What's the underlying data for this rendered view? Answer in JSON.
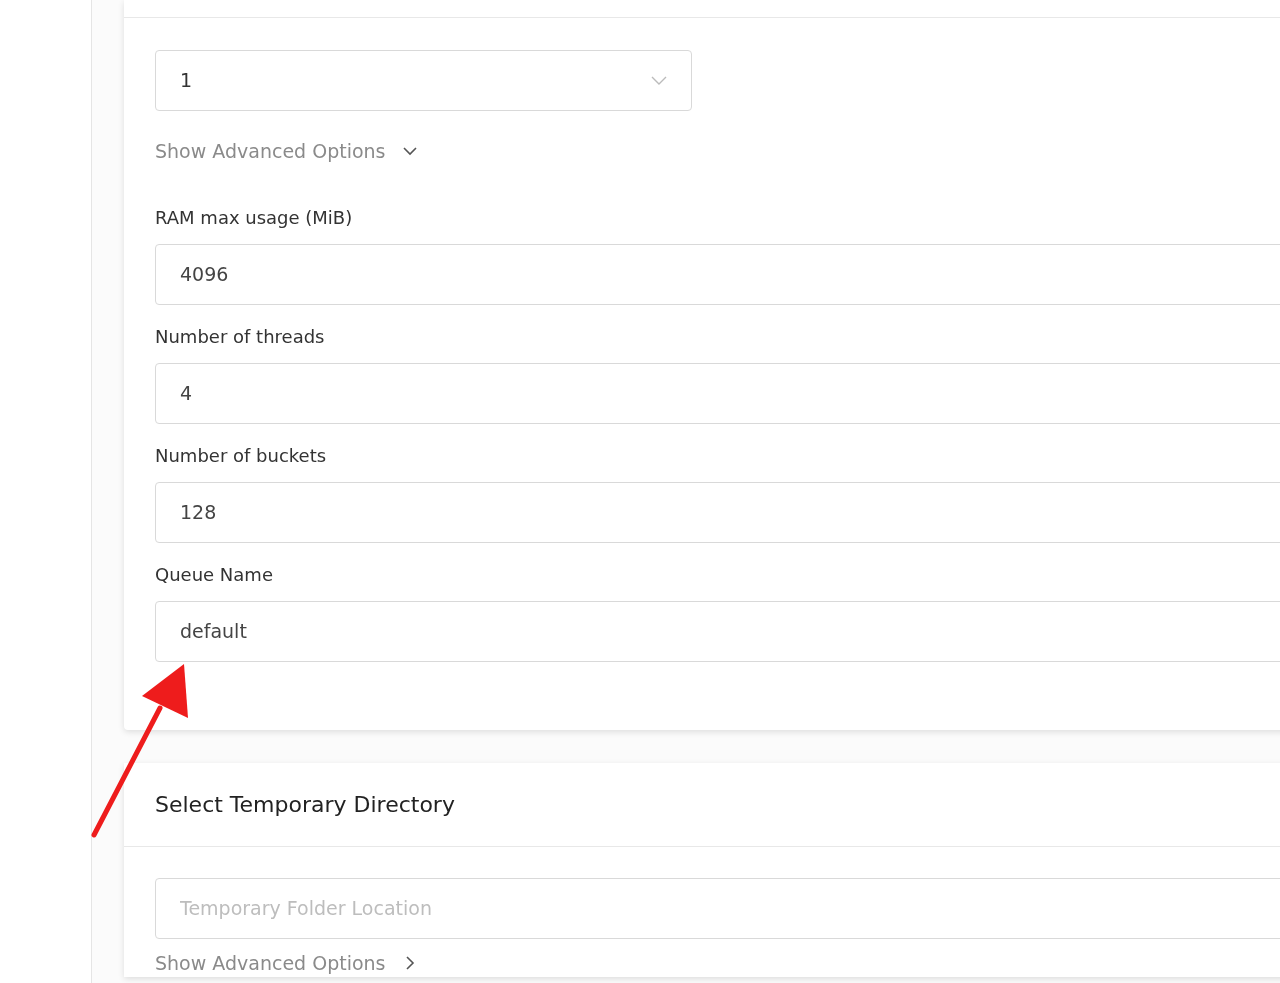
{
  "plot_card": {
    "select": {
      "value": "1"
    },
    "advanced": {
      "label": "Show Advanced Options",
      "expanded": true
    },
    "fields": [
      {
        "label": "RAM max usage (MiB)",
        "value": "4096"
      },
      {
        "label": "Number of threads",
        "value": "4"
      },
      {
        "label": "Number of buckets",
        "value": "128"
      },
      {
        "label": "Queue Name",
        "value": "default"
      }
    ]
  },
  "temp_card": {
    "title": "Select Temporary Directory",
    "field": {
      "placeholder": "Temporary Folder Location"
    },
    "advanced": {
      "label": "Show Advanced Options",
      "expanded": false
    }
  }
}
